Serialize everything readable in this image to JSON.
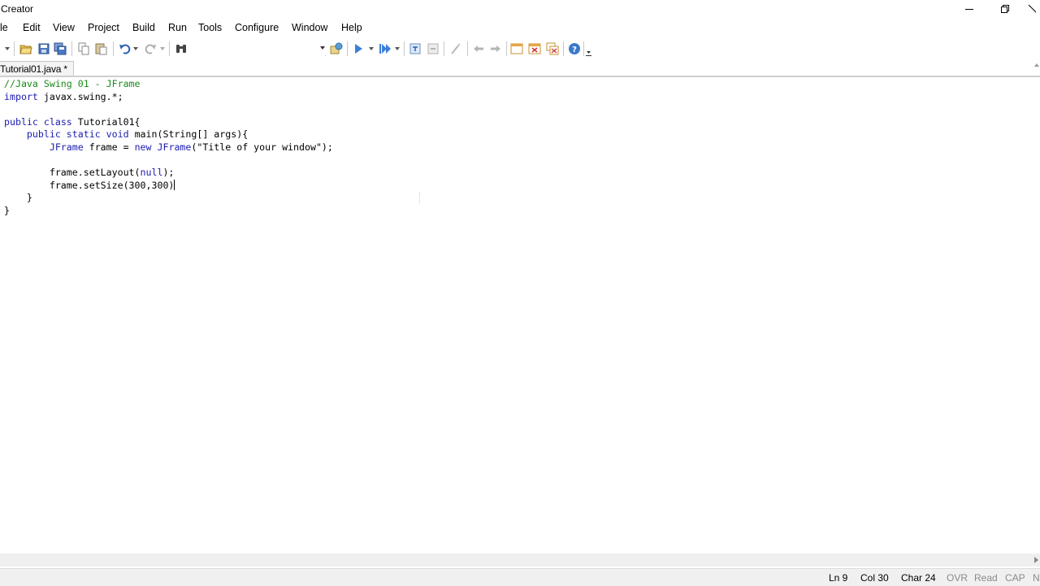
{
  "window": {
    "title": "Creator",
    "controls": [
      "minimize-icon",
      "restore-icon",
      "close-icon"
    ]
  },
  "menu": {
    "items": [
      "le",
      "Edit",
      "View",
      "Project",
      "Build",
      "Run",
      "Tools",
      "Configure",
      "Window",
      "Help"
    ]
  },
  "toolbar": {
    "icons": [
      "new-dropdown-icon",
      "open-icon",
      "save-icon",
      "save-all-icon",
      "copy-icon",
      "paste-icon",
      "undo-icon",
      "redo-icon",
      "find-icon",
      "class-icon",
      "run-icon",
      "run-dropdown-icon",
      "debug-icon",
      "debug-dropdown-icon",
      "step-icon",
      "step-over-icon",
      "magic-icon",
      "back-icon",
      "forward-icon",
      "window-icon",
      "window-close-icon",
      "window-tile-icon",
      "help-icon"
    ],
    "combo_value": ""
  },
  "tab": {
    "label": "Tutorial01.java *"
  },
  "code": {
    "lines": [
      "//Java Swing 01 - JFrame",
      "import javax.swing.*;",
      "",
      "public class Tutorial01{",
      "    public static void main(String[] args){",
      "        JFrame frame = new JFrame(\"Title of your window\");",
      "",
      "        frame.setLayout(null);",
      "        frame.setSize(300,300)",
      "    }",
      "}"
    ]
  },
  "status": {
    "ln": "Ln 9",
    "col": "Col 30",
    "char": "Char 24",
    "ovr": "OVR",
    "read": "Read",
    "cap": "CAP",
    "num": "N"
  },
  "colors": {
    "comment": "#1a8a1a",
    "keyword": "#1c1cb0",
    "statusbar": "#f0f0f0"
  }
}
